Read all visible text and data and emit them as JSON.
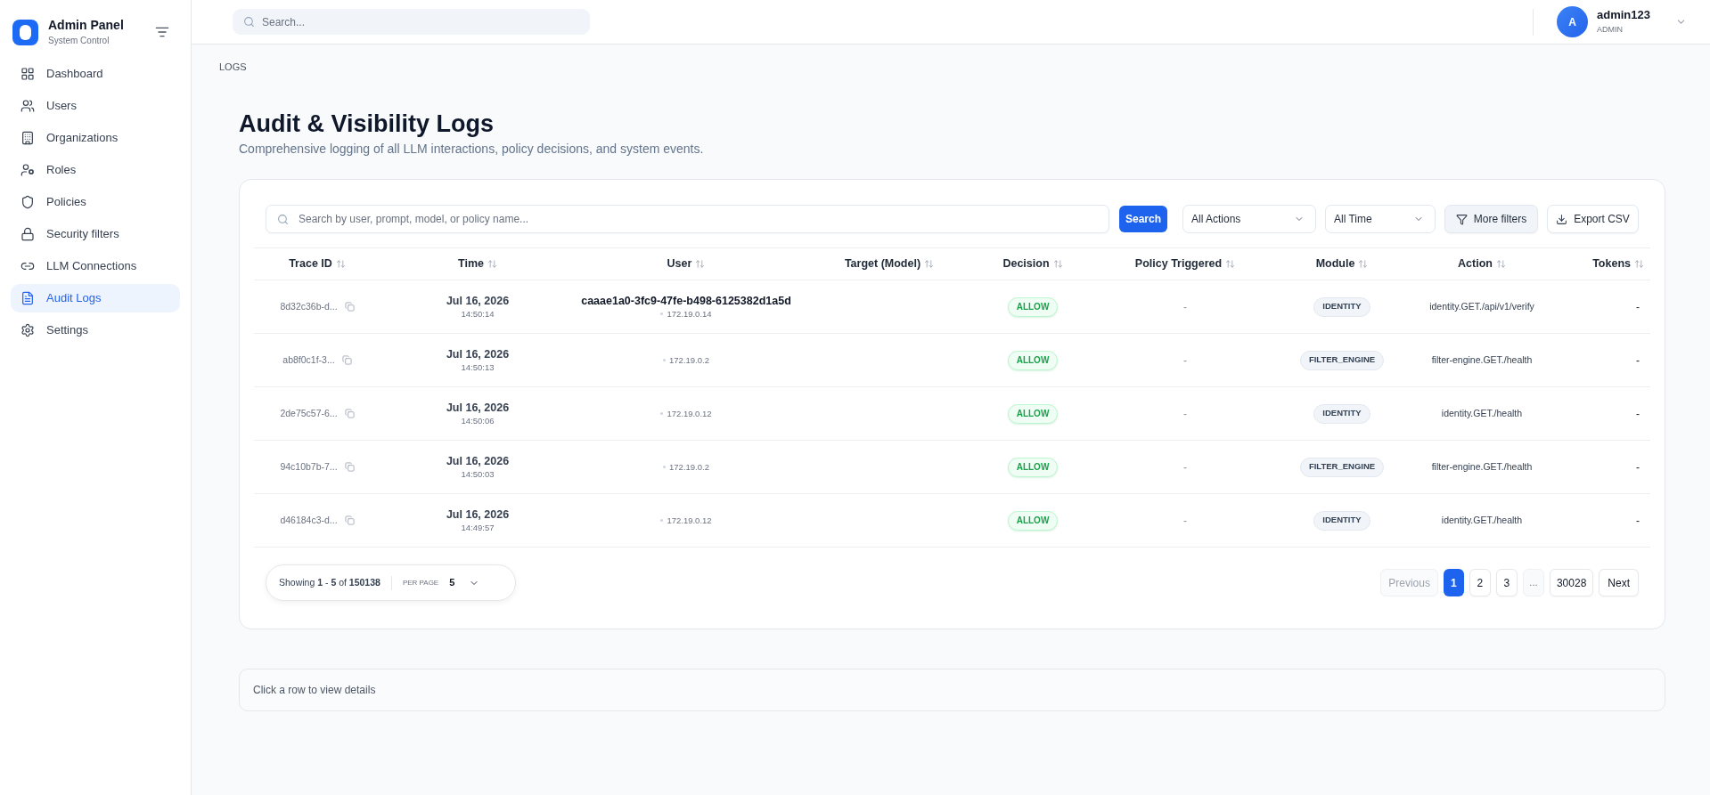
{
  "sidebar": {
    "brand": {
      "title": "Admin Panel",
      "subtitle": "System Control"
    },
    "items": [
      {
        "label": "Dashboard",
        "selected": false
      },
      {
        "label": "Users",
        "selected": false
      },
      {
        "label": "Organizations",
        "selected": false
      },
      {
        "label": "Roles",
        "selected": false
      },
      {
        "label": "Policies",
        "selected": false
      },
      {
        "label": "Security filters",
        "selected": false
      },
      {
        "label": "LLM Connections",
        "selected": false
      },
      {
        "label": "Audit Logs",
        "selected": true
      },
      {
        "label": "Settings",
        "selected": false
      }
    ]
  },
  "topbar": {
    "search": {
      "placeholder": "Search..."
    },
    "user": {
      "initial": "A",
      "name": "admin123",
      "role": "ADMIN"
    }
  },
  "breadcrumb": "LOGS",
  "header": {
    "title": "Audit & Visibility Logs",
    "subtitle": "Comprehensive logging of all LLM interactions, policy decisions, and system events."
  },
  "toolbar": {
    "search": {
      "placeholder": "Search by user, prompt, model, or policy name..."
    },
    "search_button": "Search",
    "selects": [
      {
        "value": "All Actions"
      },
      {
        "value": "All Time"
      }
    ],
    "buttons": [
      {
        "label": "More filters"
      },
      {
        "label": "Export CSV"
      }
    ]
  },
  "table": {
    "columns": [
      {
        "label": "Trace ID"
      },
      {
        "label": "Time"
      },
      {
        "label": "User"
      },
      {
        "label": "Target (Model)"
      },
      {
        "label": "Decision"
      },
      {
        "label": "Policy Triggered"
      },
      {
        "label": "Module"
      },
      {
        "label": "Action"
      },
      {
        "label": "Tokens"
      }
    ],
    "rows": [
      {
        "trace_id": "8d32c36b-d...",
        "date": "Jul 16, 2026",
        "time": "14:50:14",
        "user": "caaae1a0-3fc9-47fe-b498-6125382d1a5d",
        "ip": "172.19.0.14",
        "decision": "ALLOW",
        "policy": "-",
        "module": "IDENTITY",
        "action": "identity.GET./api/v1/verify",
        "tokens": "-"
      },
      {
        "trace_id": "ab8f0c1f-3...",
        "date": "Jul 16, 2026",
        "time": "14:50:13",
        "ip": "172.19.0.2",
        "decision": "ALLOW",
        "policy": "-",
        "module": "FILTER_ENGINE",
        "action": "filter-engine.GET./health",
        "tokens": "-"
      },
      {
        "trace_id": "2de75c57-6...",
        "date": "Jul 16, 2026",
        "time": "14:50:06",
        "ip": "172.19.0.12",
        "decision": "ALLOW",
        "policy": "-",
        "module": "IDENTITY",
        "action": "identity.GET./health",
        "tokens": "-"
      },
      {
        "trace_id": "94c10b7b-7...",
        "date": "Jul 16, 2026",
        "time": "14:50:03",
        "ip": "172.19.0.2",
        "decision": "ALLOW",
        "policy": "-",
        "module": "FILTER_ENGINE",
        "action": "filter-engine.GET./health",
        "tokens": "-"
      },
      {
        "trace_id": "d46184c3-d...",
        "date": "Jul 16, 2026",
        "time": "14:49:57",
        "ip": "172.19.0.12",
        "decision": "ALLOW",
        "policy": "-",
        "module": "IDENTITY",
        "action": "identity.GET./health",
        "tokens": "-"
      }
    ]
  },
  "pagination": {
    "summary": "Showing **1** - **5** of **150138**",
    "per_page_label": "PER PAGE",
    "per_page": "5",
    "previous": {
      "label": "Previous",
      "disabled": true
    },
    "pages": [
      {
        "kind": "page",
        "label": "1",
        "selected": true
      },
      {
        "kind": "page",
        "label": "2",
        "selected": false
      },
      {
        "kind": "page",
        "label": "3",
        "selected": false
      },
      {
        "kind": "ellipsis",
        "label": "...",
        "selected": false
      },
      {
        "kind": "page",
        "label": "30028",
        "selected": false
      }
    ],
    "next": {
      "label": "Next",
      "disabled": false
    }
  },
  "details_panel": {
    "message": "Click a row to view details"
  }
}
